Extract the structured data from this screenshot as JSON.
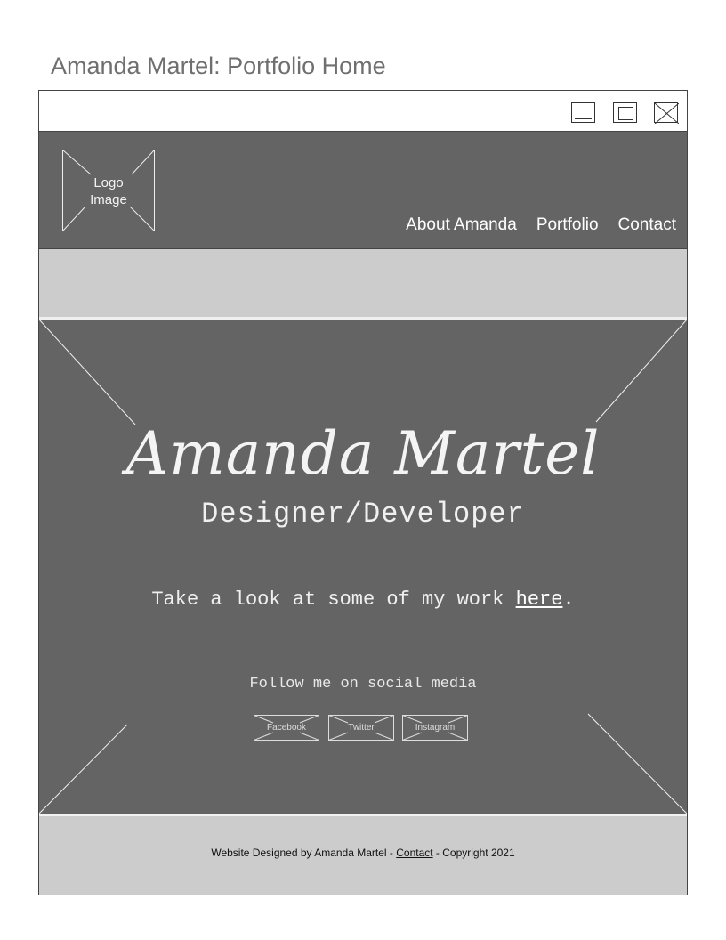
{
  "page": {
    "title": "Amanda Martel: Portfolio Home"
  },
  "window": {
    "controls": {
      "minimize": "minimize-icon",
      "maximize": "maximize-icon",
      "close": "close-icon"
    }
  },
  "header": {
    "logo_line1": "Logo",
    "logo_line2": "Image",
    "nav": [
      {
        "label": "About Amanda"
      },
      {
        "label": "Portfolio"
      },
      {
        "label": "Contact"
      }
    ]
  },
  "hero": {
    "name": "Amanda Martel",
    "role": "Designer/Developer",
    "cta_prefix": "Take a look at some of my work ",
    "cta_link": "here",
    "cta_suffix": ".",
    "follow": "Follow me on social media",
    "social": [
      {
        "label": "Facebook"
      },
      {
        "label": "Twitter"
      },
      {
        "label": "Instagram"
      }
    ]
  },
  "footer": {
    "prefix": "Website Designed by Amanda Martel - ",
    "link": "Contact",
    "suffix": " - Copyright 2021"
  },
  "colors": {
    "header_bg": "#646464",
    "band_bg": "#cccccc",
    "text_light": "#f0f0f0"
  }
}
